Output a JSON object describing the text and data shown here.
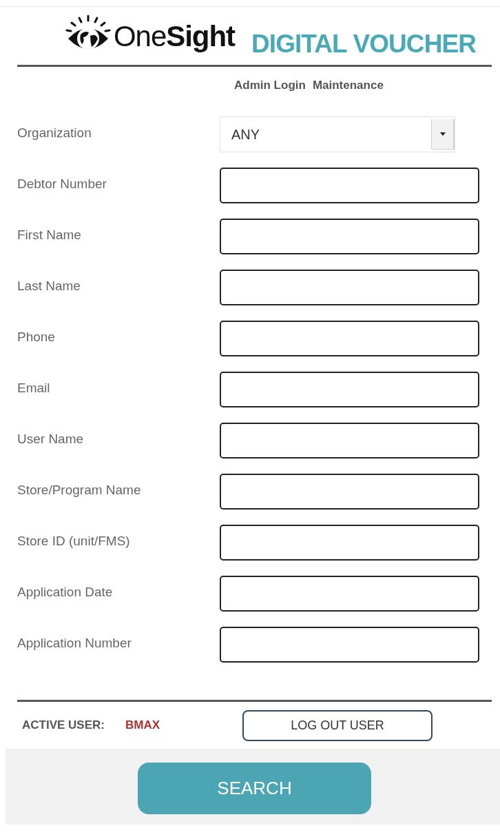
{
  "header": {
    "logo_text": "One**Sight**",
    "title": "DIGITAL VOUCHER"
  },
  "nav": [
    "Admin Login",
    "Maintenance"
  ],
  "form": {
    "fields": [
      {
        "label": "Organization",
        "kind": "select",
        "value": "ANY"
      },
      {
        "label": "Debtor Number",
        "kind": "text"
      },
      {
        "label": "First Name",
        "kind": "text"
      },
      {
        "label": "Last Name",
        "kind": "text"
      },
      {
        "label": "Phone",
        "kind": "text"
      },
      {
        "label": "Email",
        "kind": "text"
      },
      {
        "label": "User Name",
        "kind": "text"
      },
      {
        "label": "Store/Program Name",
        "kind": "text"
      },
      {
        "label": "Store ID (unit/FMS)",
        "kind": "text"
      },
      {
        "label": "Application Date",
        "kind": "text"
      },
      {
        "label": "Application Number",
        "kind": "text"
      }
    ]
  },
  "active_user": {
    "label": "ACTIVE USER:",
    "value": "BMAX"
  },
  "logout_button": "LOG OUT USER",
  "search_button": "SEARCH"
}
